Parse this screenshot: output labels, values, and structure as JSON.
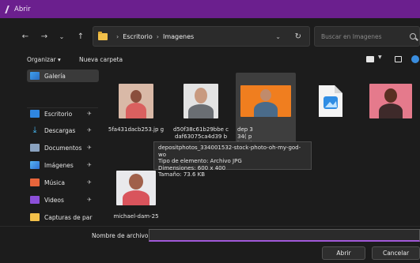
{
  "window": {
    "title": "Abrir"
  },
  "navbar": {
    "back_icon": "arrow-left-icon",
    "forward_icon": "arrow-right-icon",
    "recent_icon": "chevron-down-icon",
    "up_icon": "arrow-up-icon",
    "breadcrumb": [
      "Escritorio",
      "Imagenes"
    ],
    "search_placeholder": "Buscar en Imagenes"
  },
  "toolbar": {
    "organize_label": "Organizar ▾",
    "new_folder_label": "Nueva carpeta"
  },
  "sidebar": {
    "items": [
      {
        "label": "Galería",
        "icon": "gallery-icon",
        "pinned": false,
        "active": true
      },
      {
        "label": "Escritorio",
        "icon": "desktop-icon",
        "pinned": true
      },
      {
        "label": "Descargas",
        "icon": "download-icon",
        "pinned": true
      },
      {
        "label": "Documentos",
        "icon": "documents-icon",
        "pinned": true
      },
      {
        "label": "Imágenes",
        "icon": "images-icon",
        "pinned": true
      },
      {
        "label": "Música",
        "icon": "music-icon",
        "pinned": true
      },
      {
        "label": "Videos",
        "icon": "videos-icon",
        "pinned": true
      },
      {
        "label": "Capturas de par",
        "icon": "folder-icon",
        "pinned": false
      }
    ]
  },
  "files": [
    {
      "name": "5fa431dacb253.jp g",
      "kind": "photo"
    },
    {
      "name": "d50f38c61b29bbe cdaf63075ca4d39 b8.jpg",
      "kind": "photo"
    },
    {
      "name": "dep 334( phot d-wi",
      "kind": "photo",
      "selected": true
    },
    {
      "name": "",
      "kind": "image-file-icon"
    },
    {
      "name": "",
      "kind": "photo"
    },
    {
      "name": "michael-dam-25",
      "kind": "photo"
    }
  ],
  "tooltip": {
    "line1": "depositphotos_334001532-stock-photo-oh-my-god-wo",
    "line2": "Tipo de elemento: Archivo JPG",
    "line3": "Dimensiones: 600 x 400",
    "line4": "Tamaño: 73.6 KB"
  },
  "bottom": {
    "filename_label": "Nombre de archivo:",
    "filename_value": "",
    "open_label": "Abrir",
    "cancel_label": "Cancelar"
  }
}
